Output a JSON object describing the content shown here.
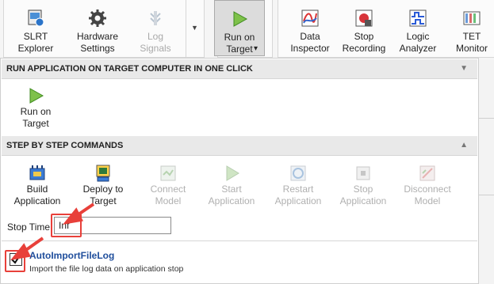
{
  "ribbon": {
    "left_group": [
      {
        "label": "SLRT\nExplorer",
        "icon": "slrt-explorer-icon",
        "enabled": true
      },
      {
        "label": "Hardware\nSettings",
        "icon": "gear-icon",
        "enabled": true
      },
      {
        "label": "Log\nSignals",
        "icon": "log-signals-icon",
        "enabled": false
      }
    ],
    "run_on_target": {
      "label": "Run on\nTarget",
      "dropdown": "▾"
    },
    "right_group": [
      {
        "label": "Data\nInspector",
        "icon": "data-inspector-icon"
      },
      {
        "label": "Stop\nRecording",
        "icon": "stop-recording-icon"
      },
      {
        "label": "Logic\nAnalyzer",
        "icon": "logic-analyzer-icon"
      },
      {
        "label": "TET\nMonitor",
        "icon": "tet-monitor-icon"
      }
    ]
  },
  "panel": {
    "section1": {
      "title": "RUN APPLICATION ON TARGET COMPUTER IN ONE CLICK",
      "run_label": "Run on\nTarget"
    },
    "section2": {
      "title": "STEP BY STEP COMMANDS",
      "commands": [
        {
          "label": "Build\nApplication",
          "icon": "build-icon",
          "enabled": true
        },
        {
          "label": "Deploy to\nTarget",
          "icon": "deploy-icon",
          "enabled": true
        },
        {
          "label": "Connect\nModel",
          "icon": "connect-icon",
          "enabled": false
        },
        {
          "label": "Start\nApplication",
          "icon": "start-icon",
          "enabled": false
        },
        {
          "label": "Restart\nApplication",
          "icon": "restart-icon",
          "enabled": false
        },
        {
          "label": "Stop\nApplication",
          "icon": "stop-icon",
          "enabled": false
        },
        {
          "label": "Disconnect\nModel",
          "icon": "disconnect-icon",
          "enabled": false
        }
      ]
    },
    "stop_time": {
      "label": "Stop Time",
      "value": "Inf"
    },
    "auto_import": {
      "title": "AutoImportFileLog",
      "description": "Import the file log data on application stop",
      "checked": true
    }
  },
  "colors": {
    "annotation": "#e8403a",
    "link": "#1f4e9c"
  }
}
